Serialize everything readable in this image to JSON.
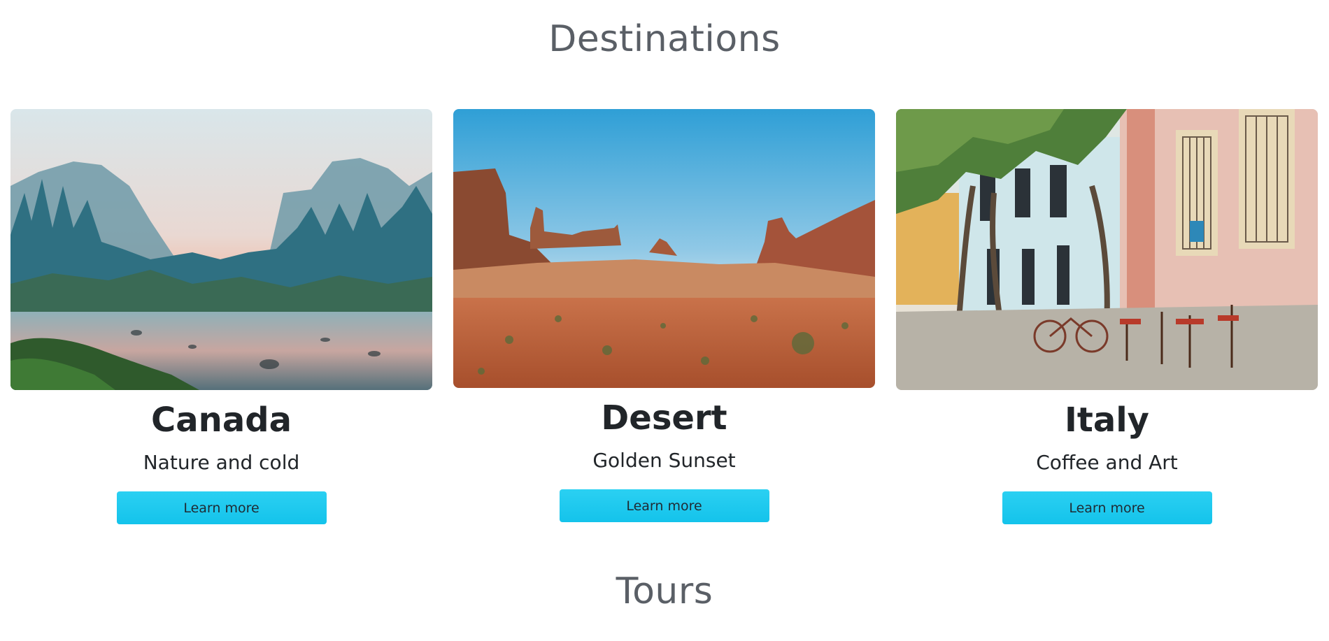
{
  "sections": {
    "destinations_title": "Destinations",
    "tours_title": "Tours"
  },
  "cards": [
    {
      "title": "Canada",
      "subtitle": "Nature and cold",
      "button_label": "Learn more",
      "image": "mountain-forest-river-photo"
    },
    {
      "title": "Desert",
      "subtitle": "Golden Sunset",
      "button_label": "Learn more",
      "image": "desert-mesa-photo"
    },
    {
      "title": "Italy",
      "subtitle": "Coffee and Art",
      "button_label": "Learn more",
      "image": "street-cafe-photo"
    }
  ],
  "colors": {
    "button": "#1dc9ef",
    "heading": "#5a5f66",
    "text": "#212529"
  }
}
